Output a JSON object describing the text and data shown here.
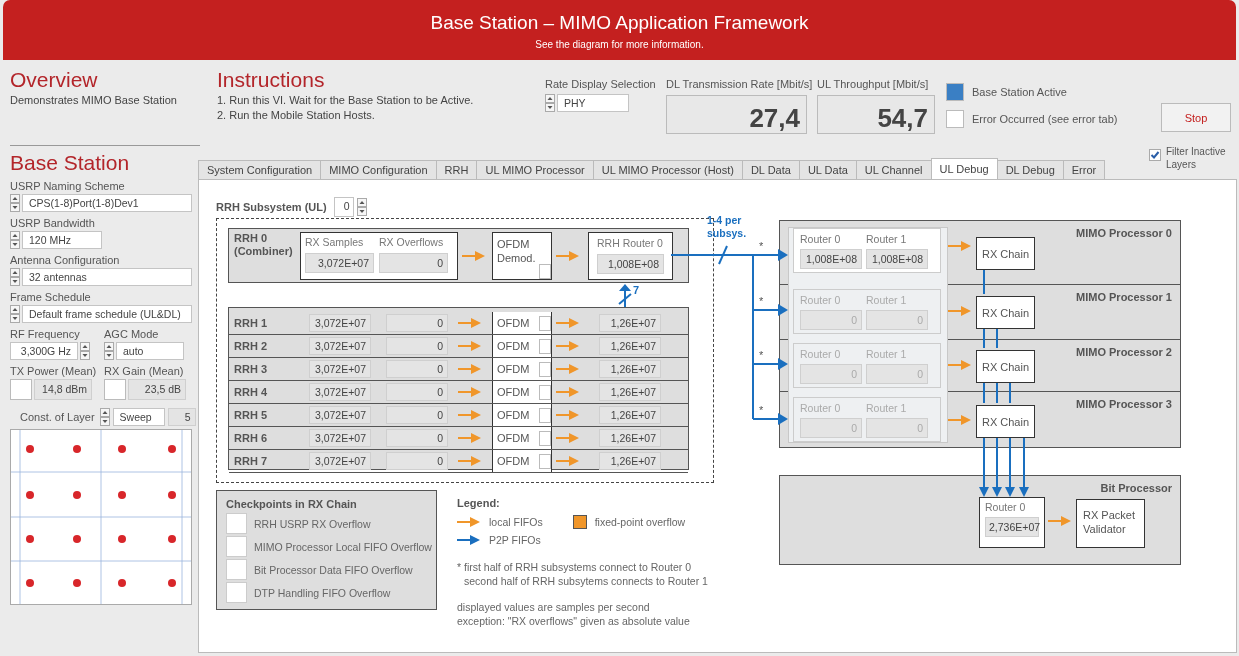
{
  "header": {
    "title": "Base Station – MIMO Application Framework",
    "subtitle": "See the diagram for more information."
  },
  "overview": {
    "title": "Overview",
    "text": "Demonstrates MIMO Base Station"
  },
  "instructions": {
    "title": "Instructions",
    "steps": [
      "1. Run this VI. Wait for the Base Station to be Active.",
      "2. Run the Mobile Station Hosts."
    ]
  },
  "rate_display": {
    "label": "Rate Display Selection",
    "value": "PHY"
  },
  "rates": [
    {
      "label": "DL Transmission Rate [Mbit/s]",
      "value": "27,4"
    },
    {
      "label": "UL Throughput [Mbit/s]",
      "value": "54,7"
    }
  ],
  "indicators": [
    {
      "label": "Base Station Active",
      "on": true
    },
    {
      "label": "Error Occurred (see error tab)",
      "on": false
    }
  ],
  "stop_button": {
    "label": "Stop"
  },
  "base_station": {
    "title": "Base Station",
    "naming_scheme": {
      "label": "USRP Naming Scheme",
      "value": "CPS(1-8)Port(1-8)Dev1"
    },
    "bandwidth": {
      "label": "USRP Bandwidth",
      "value": "120 MHz"
    },
    "antennas": {
      "label": "Antenna Configuration",
      "value": "32 antennas"
    },
    "frame_schedule": {
      "label": "Frame Schedule",
      "value": "Default frame schedule (UL&DL)"
    },
    "rf_frequency": {
      "label": "RF Frequency",
      "value": "3,300G Hz"
    },
    "agc_mode": {
      "label": "AGC Mode",
      "value": "auto"
    },
    "tx_power": {
      "label": "TX Power (Mean)",
      "value": "14,8 dBm",
      "on": false
    },
    "rx_gain": {
      "label": "RX Gain (Mean)",
      "value": "23,5 dB",
      "on": false
    },
    "constellation": {
      "label": "Const. of Layer",
      "mode": "Sweep",
      "layer": "5"
    }
  },
  "tabs": [
    {
      "label": "System Configuration",
      "selected": false
    },
    {
      "label": "MIMO Configuration",
      "selected": false
    },
    {
      "label": "RRH",
      "selected": false
    },
    {
      "label": "UL MIMO Processor",
      "selected": false
    },
    {
      "label": "UL MIMO Processor (Host)",
      "selected": false
    },
    {
      "label": "DL Data",
      "selected": false
    },
    {
      "label": "UL Data",
      "selected": false
    },
    {
      "label": "UL Channel",
      "selected": false
    },
    {
      "label": "UL Debug",
      "selected": true
    },
    {
      "label": "DL Debug",
      "selected": false
    },
    {
      "label": "Error",
      "selected": false
    }
  ],
  "filter_inactive": {
    "label": "Filter Inactive Layers",
    "checked": true
  },
  "diagram": {
    "subsystem": {
      "label": "RRH Subsystem (UL)",
      "value": "0"
    },
    "combiner": {
      "name": "RRH 0",
      "subtitle": "(Combiner)",
      "samples_label": "RX Samples",
      "overflows_label": "RX Overflows",
      "samples": "3,072E+07",
      "overflows": "0",
      "demod_label": "OFDM Demod.",
      "overflow_flag": false,
      "router_label": "RRH Router 0",
      "router_value": "1,008E+08"
    },
    "fan_in_label": "7",
    "link_label": "1-4 per subsys.",
    "rrh_rows": [
      {
        "name": "RRH 1",
        "samples": "3,072E+07",
        "overflows": "0",
        "ofdm": "OFDM",
        "overflow_flag": false,
        "router": "1,26E+07"
      },
      {
        "name": "RRH 2",
        "samples": "3,072E+07",
        "overflows": "0",
        "ofdm": "OFDM",
        "overflow_flag": false,
        "router": "1,26E+07"
      },
      {
        "name": "RRH 3",
        "samples": "3,072E+07",
        "overflows": "0",
        "ofdm": "OFDM",
        "overflow_flag": false,
        "router": "1,26E+07"
      },
      {
        "name": "RRH 4",
        "samples": "3,072E+07",
        "overflows": "0",
        "ofdm": "OFDM",
        "overflow_flag": false,
        "router": "1,26E+07"
      },
      {
        "name": "RRH 5",
        "samples": "3,072E+07",
        "overflows": "0",
        "ofdm": "OFDM",
        "overflow_flag": false,
        "router": "1,26E+07"
      },
      {
        "name": "RRH 6",
        "samples": "3,072E+07",
        "overflows": "0",
        "ofdm": "OFDM",
        "overflow_flag": false,
        "router": "1,26E+07"
      },
      {
        "name": "RRH 7",
        "samples": "3,072E+07",
        "overflows": "0",
        "ofdm": "OFDM",
        "overflow_flag": false,
        "router": "1,26E+07"
      }
    ],
    "mimo_processors": [
      {
        "name": "MIMO Processor 0",
        "disabled": false,
        "link_mark": "*",
        "router0_label": "Router 0",
        "router1_label": "Router 1",
        "router0": "1,008E+08",
        "router1": "1,008E+08",
        "rx_chain": "RX Chain"
      },
      {
        "name": "MIMO Processor 1",
        "disabled": true,
        "link_mark": "*",
        "router0_label": "Router 0",
        "router1_label": "Router 1",
        "router0": "0",
        "router1": "0",
        "rx_chain": "RX Chain"
      },
      {
        "name": "MIMO Processor 2",
        "disabled": true,
        "link_mark": "*",
        "router0_label": "Router 0",
        "router1_label": "Router 1",
        "router0": "0",
        "router1": "0",
        "rx_chain": "RX Chain"
      },
      {
        "name": "MIMO Processor 3",
        "disabled": true,
        "link_mark": "*",
        "router0_label": "Router 0",
        "router1_label": "Router 1",
        "router0": "0",
        "router1": "0",
        "rx_chain": "RX Chain"
      }
    ],
    "bit_processor": {
      "name": "Bit Processor",
      "router_label": "Router 0",
      "router_value": "2,736E+07",
      "validator": "RX Packet Validator"
    },
    "checkpoints": {
      "title": "Checkpoints in RX Chain",
      "items": [
        {
          "label": "RRH USRP RX Overflow",
          "on": false
        },
        {
          "label": "MIMO Processor Local FIFO Overflow",
          "on": false
        },
        {
          "label": "Bit Processor Data FIFO Overflow",
          "on": false
        },
        {
          "label": "DTP Handling FIFO Overflow",
          "on": false
        }
      ]
    },
    "legend": {
      "title": "Legend:",
      "items": [
        {
          "kind": "local",
          "label": "local FIFOs"
        },
        {
          "kind": "p2p",
          "label": "P2P FIFOs"
        },
        {
          "kind": "overflow",
          "label": "fixed-point overflow"
        }
      ]
    },
    "notes": [
      [
        "* first half of RRH subsystems connect to Router 0",
        "second half of RRH subsytems connects to Router 1"
      ],
      [
        "displayed values are samples per second",
        "exception: \"RX overflows\" given as absolute value"
      ]
    ]
  }
}
